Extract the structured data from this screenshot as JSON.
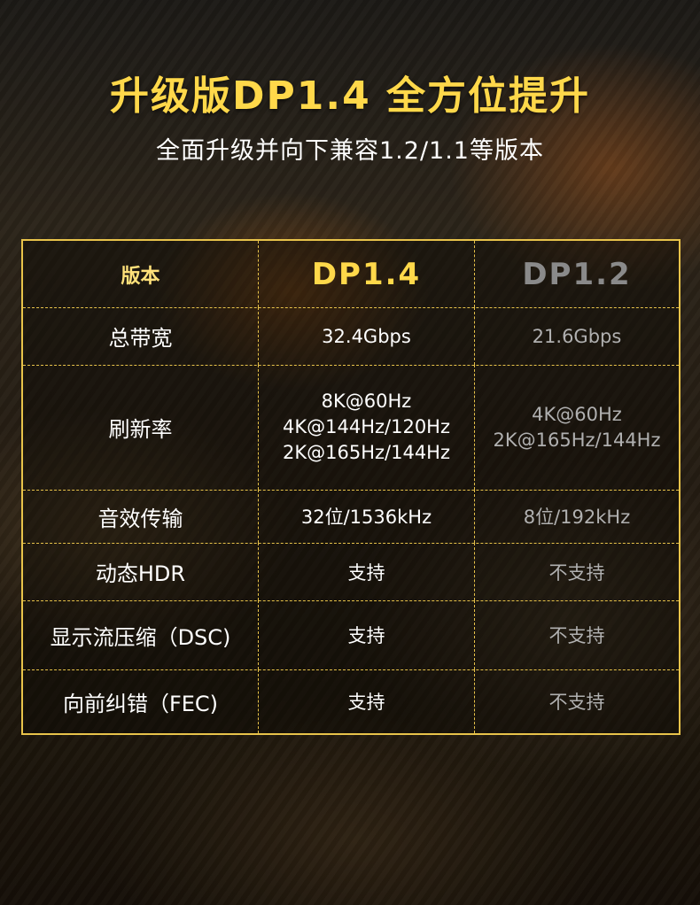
{
  "heading": {
    "title": "升级版DP1.4 全方位提升",
    "subtitle": "全面升级并向下兼容1.2/1.1等版本"
  },
  "table": {
    "header": {
      "label": "版本",
      "dp14": "DP1.4",
      "dp12": "DP1.2"
    },
    "rows": [
      {
        "label": "总带宽",
        "dp14": "32.4Gbps",
        "dp12": "21.6Gbps"
      },
      {
        "label": "刷新率",
        "dp14": [
          "8K@60Hz",
          "4K@144Hz/120Hz",
          "2K@165Hz/144Hz"
        ],
        "dp12": [
          "4K@60Hz",
          "2K@165Hz/144Hz"
        ]
      },
      {
        "label": "音效传输",
        "dp14": "32位/1536kHz",
        "dp12": "8位/192kHz"
      },
      {
        "label": "动态HDR",
        "dp14": "支持",
        "dp12": "不支持"
      },
      {
        "label": "显示流压缩（DSC)",
        "dp14": "支持",
        "dp12": "不支持"
      },
      {
        "label": "向前纠错（FEC)",
        "dp14": "支持",
        "dp12": "不支持"
      }
    ]
  },
  "colors": {
    "accent": "#ffd84a",
    "border": "#e8c34a",
    "muted": "#b0b0b0"
  }
}
